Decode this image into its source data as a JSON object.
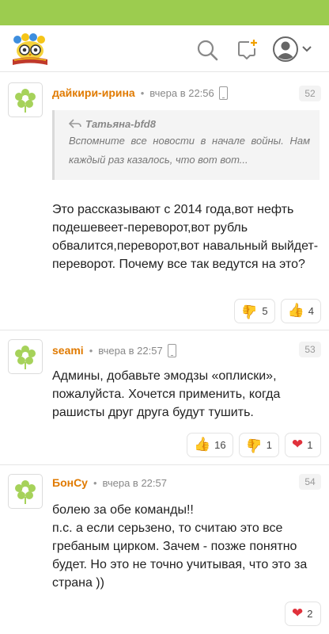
{
  "header": {
    "logo_icon": "owl-on-book-logo",
    "search_icon": "search-icon",
    "new_post_icon": "new-post-icon",
    "profile_icon": "user-avatar-icon",
    "dropdown_icon": "chevron-down-icon",
    "accent_color": "#9ccc4f"
  },
  "comments": [
    {
      "author": "дайкири-ирина",
      "time": "вчера в 22:56",
      "number": "52",
      "quote": {
        "author": "Татьяна-bfd8",
        "text": "Вспомните все новости в начале войны. Нам каждый раз казалось, что вот вот..."
      },
      "text": "Это рассказывают с 2014 года,вот нефть подешевеет-переворот,вот рубль обвалится,переворот,вот навальный выйдет-переворот. Почему все так ведутся на это?",
      "reactions": [
        {
          "icon": "thumbs-down-icon",
          "count": "5"
        },
        {
          "icon": "thumbs-up-icon",
          "count": "4"
        }
      ]
    },
    {
      "author": "seami",
      "time": "вчера в 22:57",
      "number": "53",
      "text": "Админы, добавьте эмодзы «оплиски», пожалуйста. Хочется применить, когда рашисты друг друга будут тушить.",
      "reactions": [
        {
          "icon": "thumbs-up-icon",
          "count": "16"
        },
        {
          "icon": "thumbs-down-icon",
          "count": "1"
        },
        {
          "icon": "heart-icon",
          "count": "1"
        }
      ]
    },
    {
      "author": "БонСу",
      "time": "вчера в 22:57",
      "number": "54",
      "text": "болею за обе команды!!\nп.с. а если серьзено, то считаю это все гребаным цирком. Зачем - позже понятно будет. Но это не точно учитывая, что это за страна ))",
      "reactions": [
        {
          "icon": "heart-icon",
          "count": "2"
        }
      ]
    }
  ]
}
